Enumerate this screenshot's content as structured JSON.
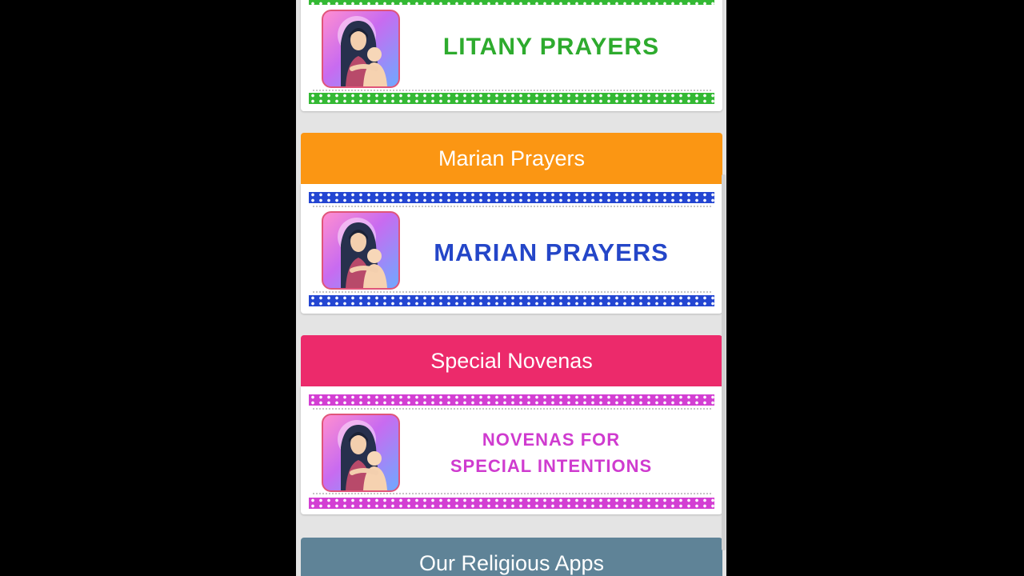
{
  "colors": {
    "litany_stripe": "#34b934",
    "litany_text": "#2eab2e",
    "marian_header": "#fb9613",
    "marian_stripe": "#2446d2",
    "marian_text": "#2446c8",
    "novena_header": "#ec2a6b",
    "novena_stripe": "#d33fd3",
    "novena_text": "#cf3bcf",
    "apps_header": "#5f8397"
  },
  "sections": {
    "litany": {
      "title": "LITANY PRAYERS",
      "thumb_icon": "madonna-and-child-icon"
    },
    "marian": {
      "header": "Marian Prayers",
      "title": "MARIAN PRAYERS",
      "thumb_icon": "madonna-and-child-icon"
    },
    "novenas": {
      "header": "Special Novenas",
      "title_line1": "NOVENAS FOR",
      "title_line2": "SPECIAL INTENTIONS",
      "thumb_icon": "madonna-and-child-icon"
    },
    "apps": {
      "header": "Our Religious Apps"
    }
  }
}
